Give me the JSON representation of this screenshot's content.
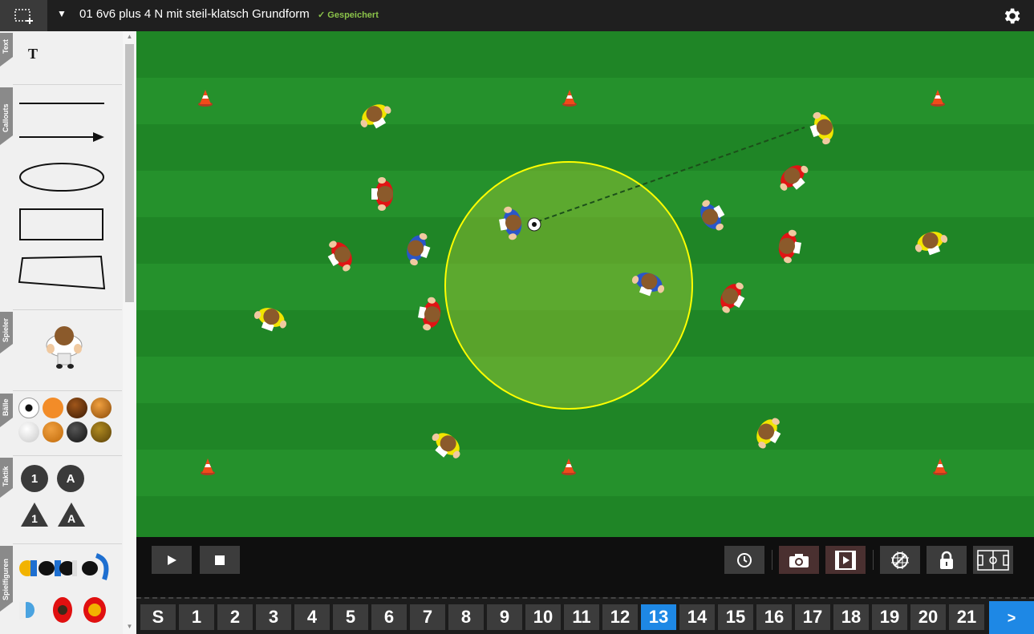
{
  "header": {
    "title": "01 6v6 plus 4 N mit steil-klatsch Grundform",
    "saved": "✓ Gespeichert",
    "new_icon": "new-scene-icon",
    "settings_icon": "gear-icon"
  },
  "sidebar": {
    "tabs": [
      "Text",
      "Callouts",
      "Spieler",
      "Bälle",
      "Taktik",
      "Spielfiguren"
    ],
    "text_tool": "T",
    "tactics": [
      "1",
      "A",
      "1",
      "A"
    ]
  },
  "field": {
    "colors": {
      "grass_light": "#25912c",
      "grass_dark": "#1f8526",
      "zone": "#ffff00"
    }
  },
  "controls": {
    "icons": [
      "play-icon",
      "stop-icon",
      "clock-icon",
      "camera-icon",
      "video-icon",
      "no-grid-icon",
      "lock-icon",
      "pitch-icon"
    ]
  },
  "frames": {
    "labels": [
      "S",
      "1",
      "2",
      "3",
      "4",
      "5",
      "6",
      "7",
      "8",
      "9",
      "10",
      "11",
      "12",
      "13",
      "14",
      "15",
      "16",
      "17",
      "18",
      "19",
      "20",
      "21"
    ],
    "active": "13",
    "next_label": ">"
  },
  "colors": {
    "accent": "#1e88e5",
    "saved": "#8bc34a"
  }
}
